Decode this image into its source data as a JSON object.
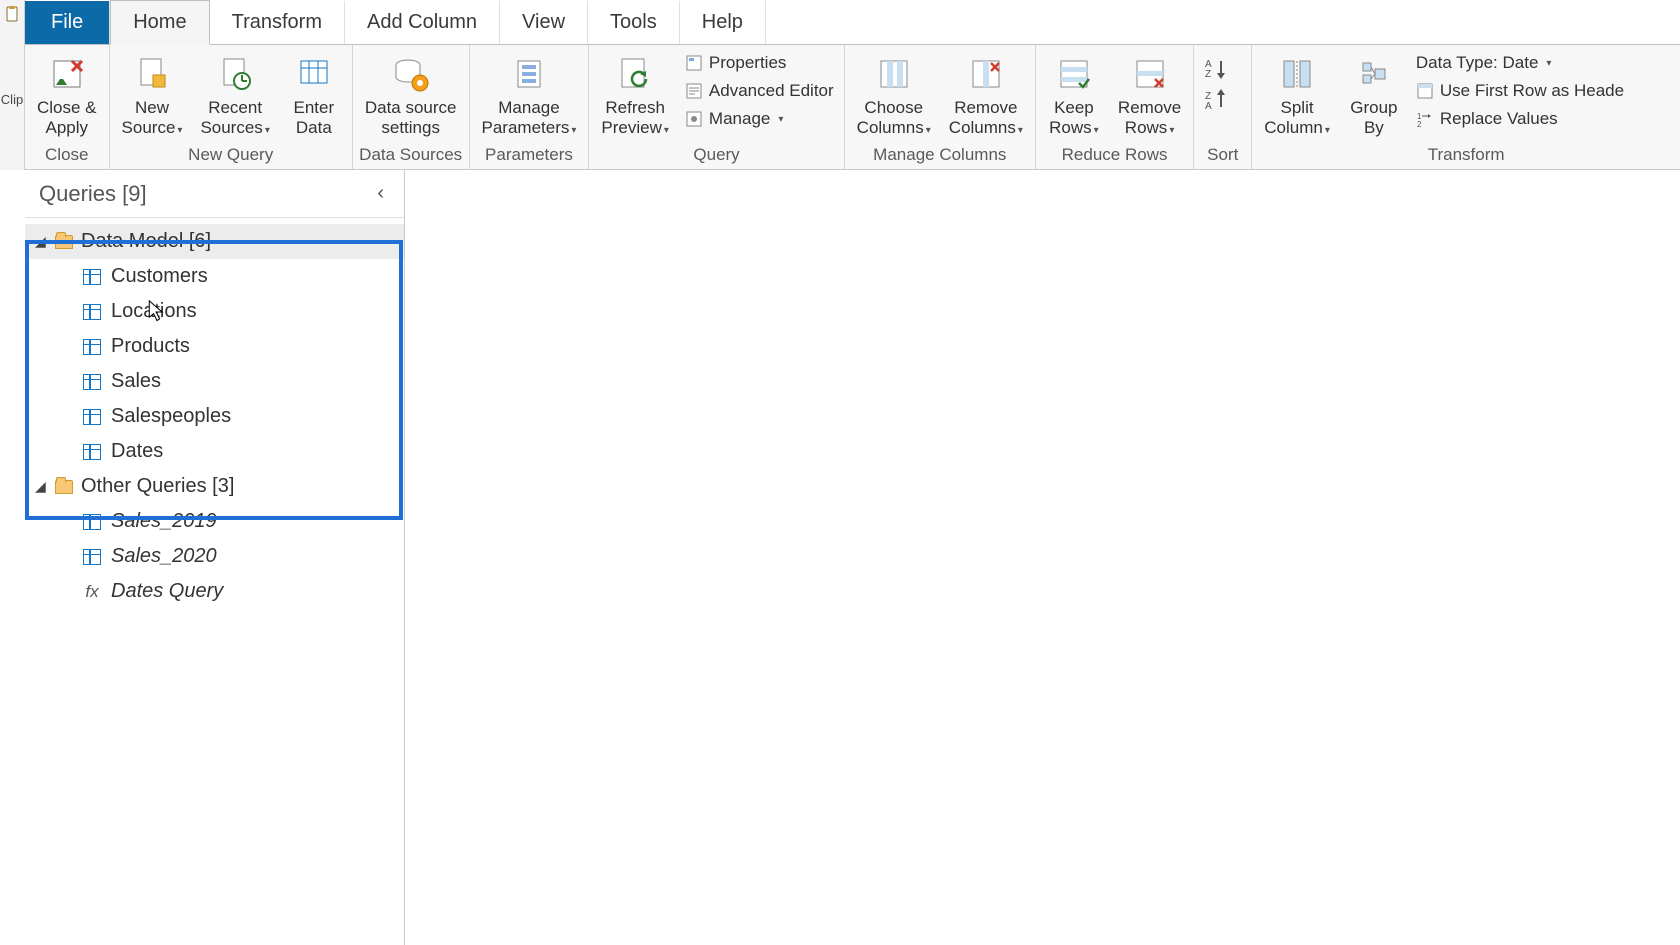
{
  "tabs": {
    "file": "File",
    "home": "Home",
    "transform": "Transform",
    "addcol": "Add Column",
    "view": "View",
    "tools": "Tools",
    "help": "Help"
  },
  "ribbon": {
    "close": {
      "closeapply": "Close &\nApply",
      "group": "Close"
    },
    "newquery": {
      "newsource": "New\nSource",
      "recent": "Recent\nSources",
      "enter": "Enter\nData",
      "group": "New Query"
    },
    "datasources": {
      "settings": "Data source\nsettings",
      "group": "Data Sources"
    },
    "parameters": {
      "manage": "Manage\nParameters",
      "group": "Parameters"
    },
    "query": {
      "refresh": "Refresh\nPreview",
      "properties": "Properties",
      "adv": "Advanced Editor",
      "manage": "Manage",
      "group": "Query"
    },
    "managecols": {
      "choose": "Choose\nColumns",
      "remove": "Remove\nColumns",
      "group": "Manage Columns"
    },
    "reducerows": {
      "keep": "Keep\nRows",
      "remove": "Remove\nRows",
      "group": "Reduce Rows"
    },
    "sort": {
      "group": "Sort"
    },
    "transform": {
      "split": "Split\nColumn",
      "group_by": "Group\nBy",
      "dtype": "Data Type: Date",
      "firstrow": "Use First Row as Heade",
      "replace": "Replace Values",
      "group": "Transform"
    }
  },
  "sidebar": {
    "title": "Queries [9]",
    "folders": [
      {
        "name": "Data Model [6]",
        "items": [
          {
            "label": "Customers",
            "type": "table"
          },
          {
            "label": "Locations",
            "type": "table"
          },
          {
            "label": "Products",
            "type": "table"
          },
          {
            "label": "Sales",
            "type": "table"
          },
          {
            "label": "Salespeoples",
            "type": "table"
          },
          {
            "label": "Dates",
            "type": "table"
          }
        ]
      },
      {
        "name": "Other Queries [3]",
        "items": [
          {
            "label": "Sales_2019",
            "type": "table",
            "italic": true
          },
          {
            "label": "Sales_2020",
            "type": "table",
            "italic": true
          },
          {
            "label": "Dates Query",
            "type": "fx",
            "italic": true
          }
        ]
      }
    ]
  },
  "leftbar": {
    "clip": "Clip"
  }
}
